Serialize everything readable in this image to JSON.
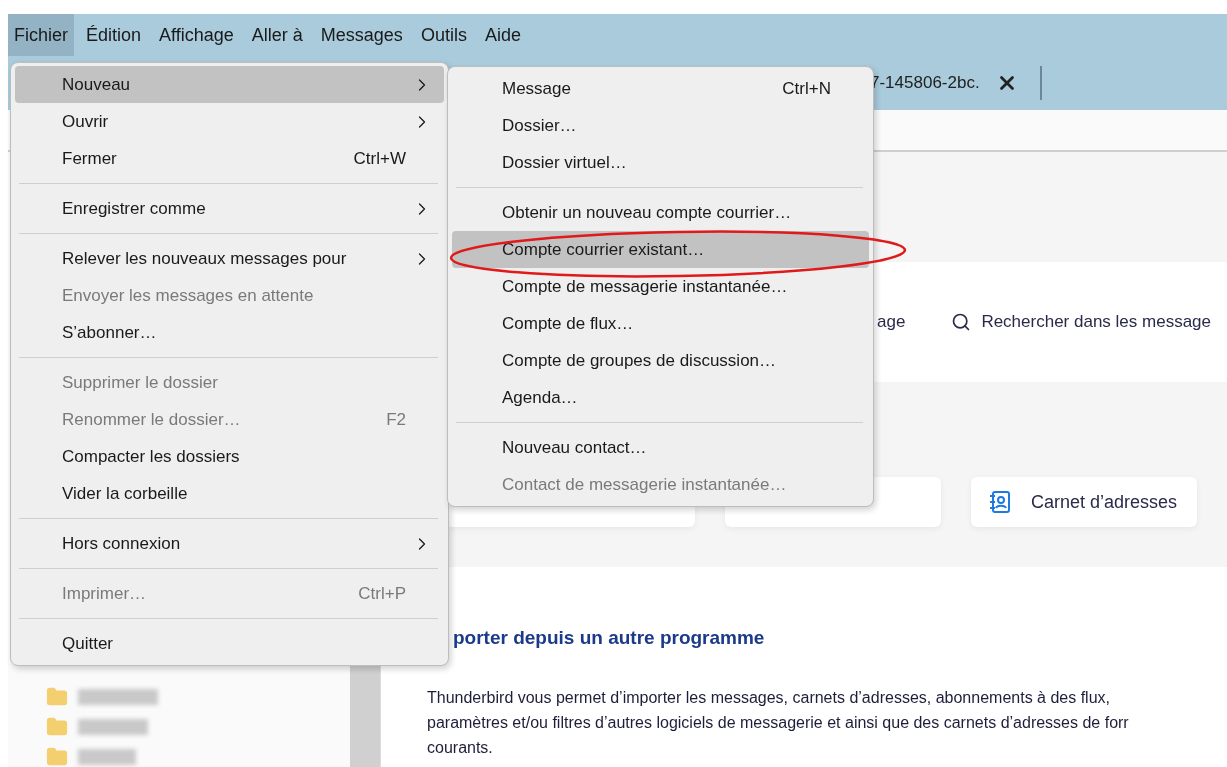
{
  "menubar": [
    {
      "label": "Fichier",
      "selected": true
    },
    {
      "label": "Édition",
      "selected": false
    },
    {
      "label": "Affichage",
      "selected": false
    },
    {
      "label": "Aller à",
      "selected": false
    },
    {
      "label": "Messages",
      "selected": false
    },
    {
      "label": "Outils",
      "selected": false
    },
    {
      "label": "Aide",
      "selected": false
    }
  ],
  "tab": {
    "title": "7-145806-2bc."
  },
  "toolbar": {
    "partial_label": "age",
    "search_label": "Rechercher dans les message"
  },
  "address_book_button": {
    "label": "Carnet d’adresses"
  },
  "import": {
    "heading": "porter depuis un autre programme",
    "lines": [
      "Thunderbird vous permet d’importer les messages, carnets d’adresses, abonnements à des flux,",
      "paramètres et/ou filtres d’autres logiciels de messagerie et ainsi que des carnets d’adresses de forr",
      "courants."
    ]
  },
  "file_menu": {
    "items": [
      {
        "kind": "item",
        "label": "Nouveau",
        "submenu": true,
        "disabled": false,
        "selected": true
      },
      {
        "kind": "item",
        "label": "Ouvrir",
        "submenu": true,
        "disabled": false,
        "selected": false
      },
      {
        "kind": "item",
        "label": "Fermer",
        "shortcut": "Ctrl+W",
        "submenu": false,
        "disabled": false,
        "selected": false
      },
      {
        "kind": "separator"
      },
      {
        "kind": "item",
        "label": "Enregistrer comme",
        "submenu": true,
        "disabled": false,
        "selected": false
      },
      {
        "kind": "separator"
      },
      {
        "kind": "item",
        "label": "Relever les nouveaux messages pour",
        "submenu": true,
        "disabled": false,
        "selected": false
      },
      {
        "kind": "item",
        "label": "Envoyer les messages en attente",
        "submenu": false,
        "disabled": true,
        "selected": false
      },
      {
        "kind": "item",
        "label": "S’abonner…",
        "submenu": false,
        "disabled": false,
        "selected": false
      },
      {
        "kind": "separator"
      },
      {
        "kind": "item",
        "label": "Supprimer le dossier",
        "submenu": false,
        "disabled": true,
        "selected": false
      },
      {
        "kind": "item",
        "label": "Renommer le dossier…",
        "shortcut": "F2",
        "submenu": false,
        "disabled": true,
        "selected": false
      },
      {
        "kind": "item",
        "label": "Compacter les dossiers",
        "submenu": false,
        "disabled": false,
        "selected": false
      },
      {
        "kind": "item",
        "label": "Vider la corbeille",
        "submenu": false,
        "disabled": false,
        "selected": false
      },
      {
        "kind": "separator"
      },
      {
        "kind": "item",
        "label": "Hors connexion",
        "submenu": true,
        "disabled": false,
        "selected": false
      },
      {
        "kind": "separator"
      },
      {
        "kind": "item",
        "label": "Imprimer…",
        "shortcut": "Ctrl+P",
        "submenu": false,
        "disabled": true,
        "selected": false
      },
      {
        "kind": "separator"
      },
      {
        "kind": "item",
        "label": "Quitter",
        "submenu": false,
        "disabled": false,
        "selected": false
      }
    ]
  },
  "new_submenu": {
    "items": [
      {
        "kind": "item",
        "label": "Message",
        "shortcut": "Ctrl+N",
        "disabled": false,
        "selected": false
      },
      {
        "kind": "item",
        "label": "Dossier…",
        "disabled": false,
        "selected": false
      },
      {
        "kind": "item",
        "label": "Dossier virtuel…",
        "disabled": false,
        "selected": false
      },
      {
        "kind": "separator"
      },
      {
        "kind": "item",
        "label": "Obtenir un nouveau compte courrier…",
        "disabled": false,
        "selected": false
      },
      {
        "kind": "item",
        "label": "Compte courrier existant…",
        "disabled": false,
        "selected": true
      },
      {
        "kind": "item",
        "label": "Compte de messagerie instantanée…",
        "disabled": false,
        "selected": false
      },
      {
        "kind": "item",
        "label": "Compte de flux…",
        "disabled": false,
        "selected": false
      },
      {
        "kind": "item",
        "label": "Compte de groupes de discussion…",
        "disabled": false,
        "selected": false
      },
      {
        "kind": "item",
        "label": "Agenda…",
        "disabled": false,
        "selected": false
      },
      {
        "kind": "separator"
      },
      {
        "kind": "item",
        "label": "Nouveau contact…",
        "disabled": false,
        "selected": false
      },
      {
        "kind": "item",
        "label": "Contact de messagerie instantanée…",
        "disabled": true,
        "selected": false
      }
    ]
  }
}
